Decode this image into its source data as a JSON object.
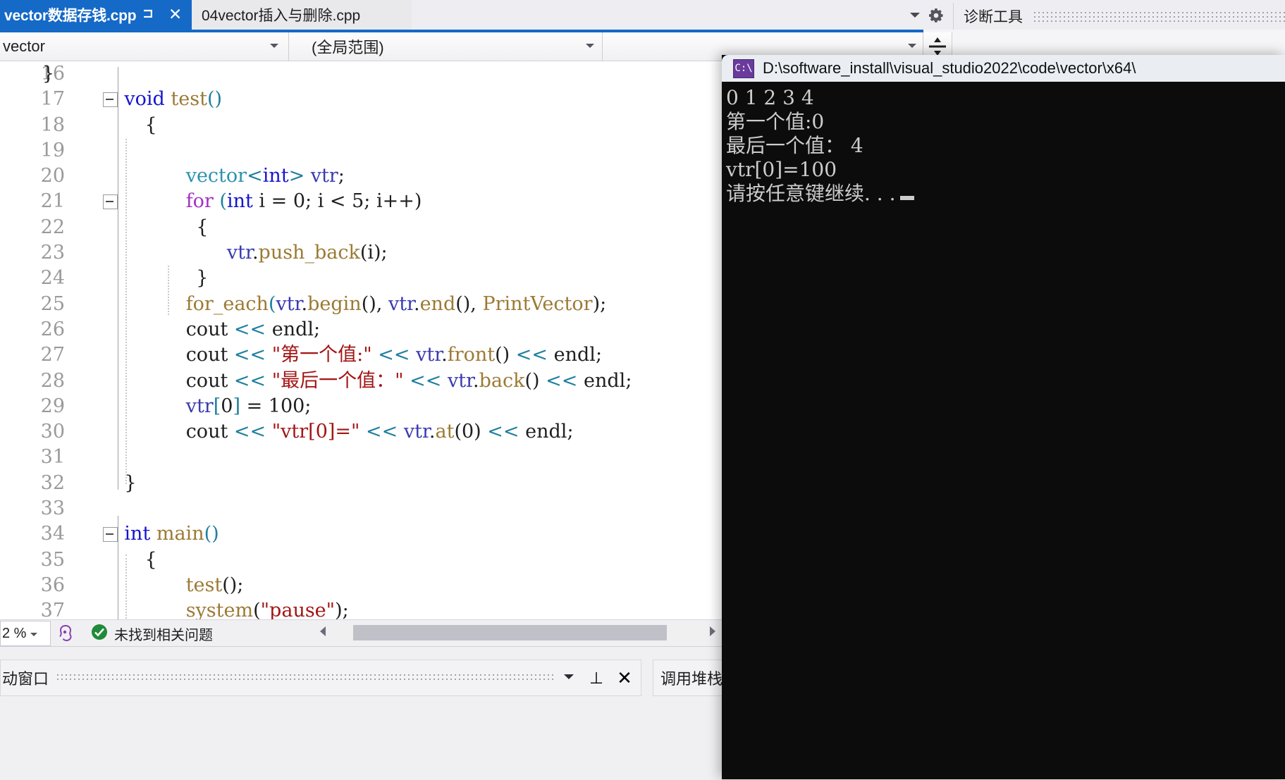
{
  "window": {
    "app": "Visual Studio"
  },
  "tabs": [
    {
      "label": "vector数据存钱.cpp",
      "active": true,
      "pin_icon": "pin-icon",
      "close_icon": "close-icon"
    },
    {
      "label": "04vector插入与删除.cpp",
      "active": false
    }
  ],
  "tab_overflow_icon": "chevron-down-icon",
  "tab_settings_icon": "gear-icon",
  "diagnostics": {
    "title": "诊断工具",
    "tools": [
      "gear-icon",
      "select-tool-icon",
      "zoom-in-icon",
      "zoom-out-icon"
    ]
  },
  "navbar": {
    "project": "vector",
    "scope": "(全局范围)",
    "member": "",
    "caret_icon": "chevron-down-icon",
    "split_icon": "split-view-icon"
  },
  "editor": {
    "first_line_number": 16,
    "lines": [
      {
        "n": 16,
        "tokens": [
          {
            "t": "}",
            "c": "plain",
            "indent": 8
          }
        ]
      },
      {
        "n": 17,
        "collapse": true,
        "tokens": [
          {
            "t": "void",
            "c": "kw"
          },
          {
            "t": " ",
            "c": "plain"
          },
          {
            "t": "test",
            "c": "fn"
          },
          {
            "t": "()",
            "c": "br"
          }
        ],
        "indent": 8
      },
      {
        "n": 18,
        "tokens": [
          {
            "t": "{",
            "c": "plain"
          }
        ],
        "indent": 10
      },
      {
        "n": 19,
        "tokens": []
      },
      {
        "n": 20,
        "tokens": [
          {
            "t": "vector",
            "c": "typ"
          },
          {
            "t": "<",
            "c": "br"
          },
          {
            "t": "int",
            "c": "kw"
          },
          {
            "t": "> ",
            "c": "br"
          },
          {
            "t": "vtr",
            "c": "var"
          },
          {
            "t": ";",
            "c": "plain"
          }
        ],
        "indent": 14
      },
      {
        "n": 21,
        "collapse": true,
        "tokens": [
          {
            "t": "for",
            "c": "kw2"
          },
          {
            "t": " (",
            "c": "br"
          },
          {
            "t": "int",
            "c": "kw"
          },
          {
            "t": " i = 0; i < 5; i++)",
            "c": "plain"
          }
        ],
        "indent": 14
      },
      {
        "n": 22,
        "tokens": [
          {
            "t": "{",
            "c": "plain"
          }
        ],
        "indent": 15
      },
      {
        "n": 23,
        "tokens": [
          {
            "t": "vtr",
            "c": "var"
          },
          {
            "t": ".",
            "c": "plain"
          },
          {
            "t": "push_back",
            "c": "fn"
          },
          {
            "t": "(i);",
            "c": "plain"
          }
        ],
        "indent": 18
      },
      {
        "n": 24,
        "tokens": [
          {
            "t": "}",
            "c": "plain"
          }
        ],
        "indent": 15
      },
      {
        "n": 25,
        "tokens": [
          {
            "t": "for_each",
            "c": "fn"
          },
          {
            "t": "(",
            "c": "br"
          },
          {
            "t": "vtr",
            "c": "var"
          },
          {
            "t": ".",
            "c": "plain"
          },
          {
            "t": "begin",
            "c": "fn"
          },
          {
            "t": "(), ",
            "c": "plain"
          },
          {
            "t": "vtr",
            "c": "var"
          },
          {
            "t": ".",
            "c": "plain"
          },
          {
            "t": "end",
            "c": "fn"
          },
          {
            "t": "(), ",
            "c": "plain"
          },
          {
            "t": "PrintVector",
            "c": "fn"
          },
          {
            "t": ");",
            "c": "plain"
          }
        ],
        "indent": 14
      },
      {
        "n": 26,
        "tokens": [
          {
            "t": "cout",
            "c": "plain"
          },
          {
            "t": " << ",
            "c": "op"
          },
          {
            "t": "endl",
            "c": "plain"
          },
          {
            "t": ";",
            "c": "plain"
          }
        ],
        "indent": 14
      },
      {
        "n": 27,
        "tokens": [
          {
            "t": "cout",
            "c": "plain"
          },
          {
            "t": " << ",
            "c": "op"
          },
          {
            "t": "\"第一个值:\"",
            "c": "str"
          },
          {
            "t": " << ",
            "c": "op"
          },
          {
            "t": "vtr",
            "c": "var"
          },
          {
            "t": ".",
            "c": "plain"
          },
          {
            "t": "front",
            "c": "fn"
          },
          {
            "t": "()",
            "c": "plain"
          },
          {
            "t": " << ",
            "c": "op"
          },
          {
            "t": "endl",
            "c": "plain"
          },
          {
            "t": ";",
            "c": "plain"
          }
        ],
        "indent": 14
      },
      {
        "n": 28,
        "tokens": [
          {
            "t": "cout",
            "c": "plain"
          },
          {
            "t": " << ",
            "c": "op"
          },
          {
            "t": "\"最后一个值：\"",
            "c": "str"
          },
          {
            "t": " << ",
            "c": "op"
          },
          {
            "t": "vtr",
            "c": "var"
          },
          {
            "t": ".",
            "c": "plain"
          },
          {
            "t": "back",
            "c": "fn"
          },
          {
            "t": "()",
            "c": "plain"
          },
          {
            "t": " << ",
            "c": "op"
          },
          {
            "t": "endl",
            "c": "plain"
          },
          {
            "t": ";",
            "c": "plain"
          }
        ],
        "indent": 14
      },
      {
        "n": 29,
        "tokens": [
          {
            "t": "vtr",
            "c": "var"
          },
          {
            "t": "[",
            "c": "br"
          },
          {
            "t": "0",
            "c": "plain"
          },
          {
            "t": "]",
            "c": "br"
          },
          {
            "t": " = 100;",
            "c": "plain"
          }
        ],
        "indent": 14
      },
      {
        "n": 30,
        "tokens": [
          {
            "t": "cout",
            "c": "plain"
          },
          {
            "t": " << ",
            "c": "op"
          },
          {
            "t": "\"vtr[0]=\"",
            "c": "str"
          },
          {
            "t": " << ",
            "c": "op"
          },
          {
            "t": "vtr",
            "c": "var"
          },
          {
            "t": ".",
            "c": "plain"
          },
          {
            "t": "at",
            "c": "fn"
          },
          {
            "t": "(0)",
            "c": "plain"
          },
          {
            "t": " << ",
            "c": "op"
          },
          {
            "t": "endl",
            "c": "plain"
          },
          {
            "t": ";",
            "c": "plain"
          }
        ],
        "indent": 14
      },
      {
        "n": 31,
        "tokens": []
      },
      {
        "n": 32,
        "tokens": [
          {
            "t": "}",
            "c": "plain"
          }
        ],
        "indent": 8
      },
      {
        "n": 33,
        "tokens": []
      },
      {
        "n": 34,
        "collapse": true,
        "tokens": [
          {
            "t": "int",
            "c": "kw"
          },
          {
            "t": " ",
            "c": "plain"
          },
          {
            "t": "main",
            "c": "fn"
          },
          {
            "t": "()",
            "c": "br"
          }
        ],
        "indent": 8
      },
      {
        "n": 35,
        "tokens": [
          {
            "t": "{",
            "c": "plain"
          }
        ],
        "indent": 10
      },
      {
        "n": 36,
        "tokens": [
          {
            "t": "test",
            "c": "fn"
          },
          {
            "t": "();",
            "c": "plain"
          }
        ],
        "indent": 14
      },
      {
        "n": 37,
        "tokens": [
          {
            "t": "system",
            "c": "fn"
          },
          {
            "t": "(",
            "c": "plain"
          },
          {
            "t": "\"pause\"",
            "c": "str"
          },
          {
            "t": ");",
            "c": "plain"
          }
        ],
        "indent": 14
      }
    ]
  },
  "status_bar": {
    "zoom": "2 %",
    "zoom_caret_icon": "chevron-down-icon",
    "intellicode_icon": "brain-icon",
    "issue_status_icon": "check-circle-icon",
    "issue_status": "未找到相关问题",
    "scroll_left_icon": "triangle-left-icon",
    "scroll_right_icon": "triangle-right-icon"
  },
  "bottom_panels": {
    "autos": {
      "title": "动窗口",
      "caret_icon": "chevron-down-icon",
      "pin_icon": "pin-icon",
      "close_icon": "close-icon"
    },
    "callstack": {
      "title": "调用堆栈"
    }
  },
  "console": {
    "icon": "console-app-icon",
    "title": "D:\\software_install\\visual_studio2022\\code\\vector\\x64\\",
    "lines": [
      "0 1 2 3 4",
      "第一个值:0",
      "最后一个值： 4",
      "vtr[0]=100",
      "请按任意键继续. . ."
    ],
    "caret": "block-cursor"
  },
  "colors": {
    "accent": "#1569c7",
    "tab_active_bg": "#1569c7",
    "tab_inactive_bg": "#e9e9ec",
    "chrome_bg": "#eeeef2",
    "editor_bg": "#ffffff",
    "keyword": "#1515d0",
    "keyword_control": "#a031c4",
    "type": "#2b91af",
    "string": "#a31515",
    "function": "#9c7a34",
    "operator": "#1f7f9f",
    "variable": "#3a3ab0",
    "line_number": "#9a9a9a",
    "console_bg": "#0c0c0c",
    "console_fg": "#cccccc",
    "ok_green": "#1f8a39"
  }
}
